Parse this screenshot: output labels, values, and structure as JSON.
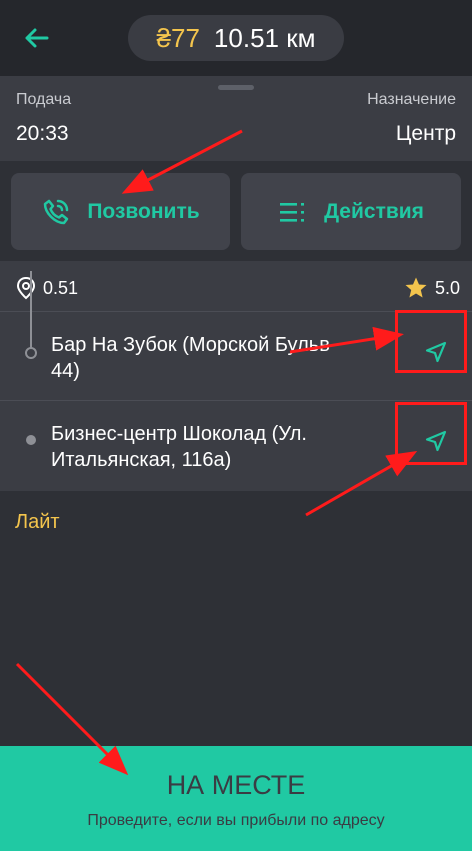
{
  "topbar": {
    "back_icon": "arrow-left-icon",
    "price": "₴77",
    "distance": "10.51 км",
    "accent_color": "#20c9a3",
    "price_color": "#f4c54d"
  },
  "order": {
    "pickup_label": "Подача",
    "pickup_time": "20:33",
    "destination_label": "Назначение",
    "destination_value": "Центр"
  },
  "actions": {
    "call_label": "Позвонить",
    "call_icon": "phone-icon",
    "menu_label": "Действия",
    "menu_icon": "list-icon"
  },
  "stats": {
    "distance_to_client": "0.51",
    "pin_icon": "location-pin-icon",
    "rating": "5.0",
    "star_icon": "star-icon"
  },
  "route": [
    {
      "address": "Бар На Зубок (Морской Бульв\n44)",
      "nav_icon": "navigate-icon"
    },
    {
      "address": "Бизнес-центр Шоколад (Ул.\nИтальянская, 116а)",
      "nav_icon": "navigate-icon"
    }
  ],
  "tariff": "Лайт",
  "arrive": {
    "title": "НА МЕСТЕ",
    "hint": "Проведите, если вы прибыли по адресу"
  },
  "annotations": {
    "color": "#ff1b1b"
  }
}
